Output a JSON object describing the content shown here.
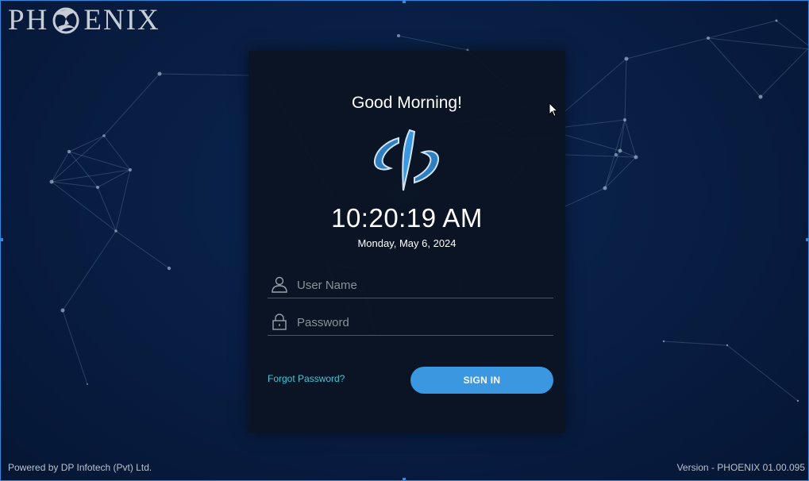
{
  "brand": {
    "name_left": "PH",
    "name_right": "ENIX",
    "emblem": "phoenix-emblem"
  },
  "login": {
    "greeting": "Good Morning!",
    "logo": "dp-logo",
    "time": "10:20:19 AM",
    "date": "Monday, May 6, 2024",
    "username_placeholder": "User Name",
    "username_value": "",
    "password_placeholder": "Password",
    "password_value": "",
    "username_icon": "user-icon",
    "password_icon": "lock-icon",
    "forgot_label": "Forgot Password?",
    "signin_label": "SIGN IN"
  },
  "footer": {
    "powered_by": "Powered by DP Infotech (Pvt) Ltd.",
    "version": "Version - PHOENIX 01.00.095"
  },
  "colors": {
    "background": "#081d42",
    "panel": "#0b1422",
    "accent": "#3a97e0",
    "link": "#3ec7d8"
  }
}
